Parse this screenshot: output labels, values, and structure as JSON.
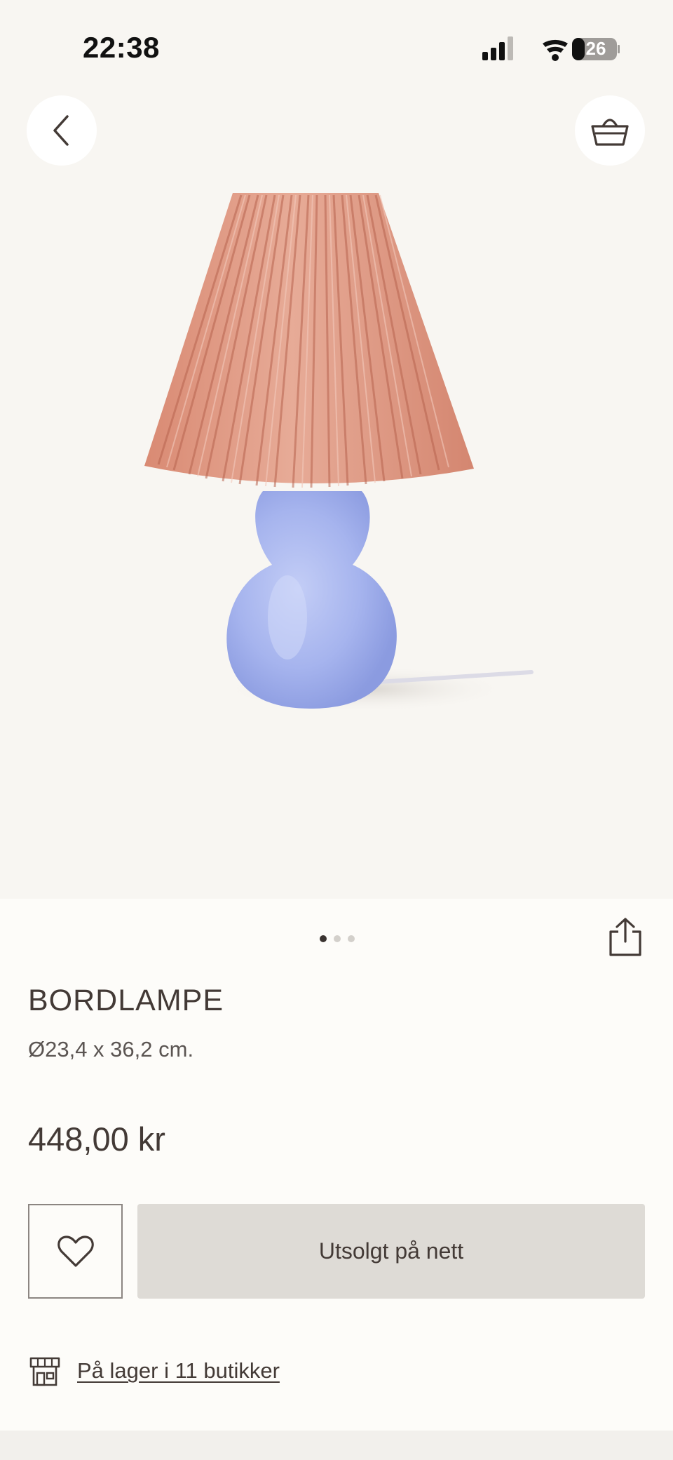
{
  "status_bar": {
    "time": "22:38",
    "battery": "26",
    "icons": [
      "signal-icon",
      "wifi-icon",
      "battery-icon"
    ]
  },
  "nav": {
    "back_icon": "chevron-left-icon",
    "basket_icon": "basket-icon"
  },
  "gallery": {
    "page_count": 3,
    "active_page": 1,
    "share_icon": "share-icon"
  },
  "product": {
    "title": "BORDLAMPE",
    "dimensions": "Ø23,4 x 36,2 cm.",
    "price": "448,00 kr"
  },
  "actions": {
    "favorite_icon": "heart-icon",
    "soldout_label": "Utsolgt på nett"
  },
  "store": {
    "icon": "store-icon",
    "link_text": "På lager i 11 butikker"
  },
  "colors": {
    "background": "#fdfcf9",
    "hero_background": "#f8f6f2",
    "text": "#433a36",
    "button_disabled": "#dedbd6",
    "lamp_shade": "#d9907a",
    "lamp_base": "#a9b7ee"
  }
}
